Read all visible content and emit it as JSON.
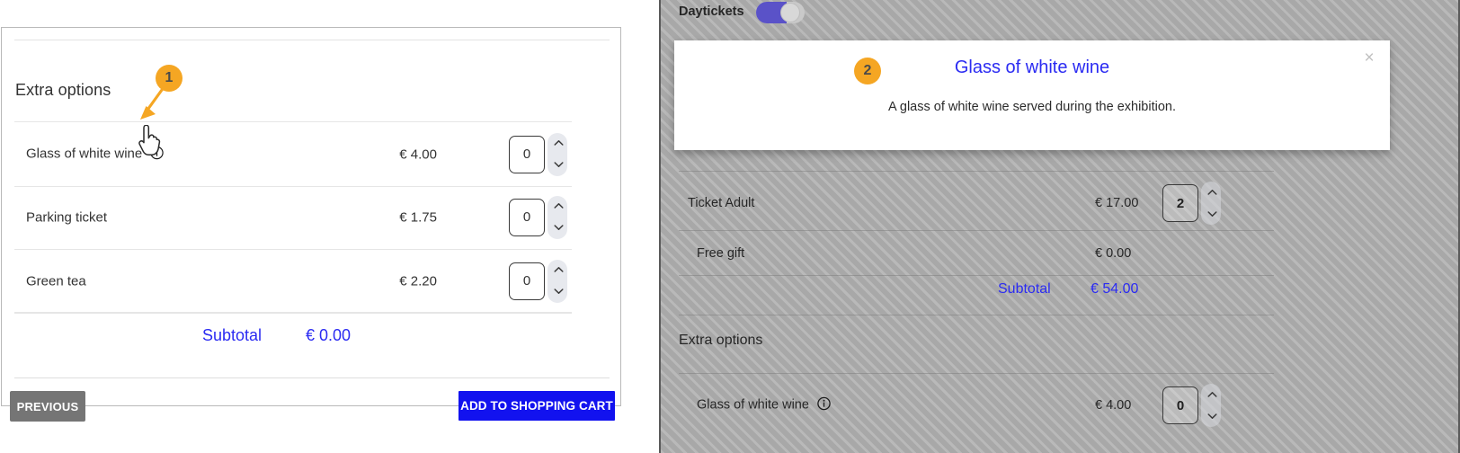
{
  "left_panel": {
    "section_title": "Extra options",
    "rows": [
      {
        "label": "Glass of white wine",
        "price": "€ 4.00",
        "qty": "0",
        "has_info": true
      },
      {
        "label": "Parking ticket",
        "price": "€ 1.75",
        "qty": "0",
        "has_info": false
      },
      {
        "label": "Green tea",
        "price": "€ 2.20",
        "qty": "0",
        "has_info": false
      }
    ],
    "subtotal_label": "Subtotal",
    "subtotal_value": "€ 0.00",
    "previous_label": "PREVIOUS",
    "add_cart_label": "ADD TO SHOPPING CART"
  },
  "right_panel": {
    "toggle_label": "Daytickets",
    "toggle_state": "on",
    "rows": [
      {
        "label": "Ticket Adult",
        "price": "€ 17.00",
        "qty": "2",
        "has_stepper": true
      },
      {
        "label": "Free gift",
        "price": "€ 0.00",
        "qty": "",
        "has_stepper": false
      }
    ],
    "subtotal_label": "Subtotal",
    "subtotal_value": "€ 54.00",
    "extra_options_title": "Extra options",
    "extra_rows": [
      {
        "label": "Glass of white wine",
        "price": "€ 4.00",
        "qty": "0",
        "has_info": true
      }
    ]
  },
  "modal": {
    "title": "Glass of white wine",
    "body": "A glass of white wine served during the exhibition.",
    "close_label": "×"
  },
  "callouts": [
    {
      "id": "1",
      "number": "1"
    },
    {
      "id": "2",
      "number": "2"
    }
  ],
  "colors": {
    "accent_blue": "#2b2bf2",
    "button_blue": "#1212ef",
    "badge_orange": "#f5a623",
    "toggle_on": "#5a52c8",
    "previous_gray": "#757575"
  }
}
